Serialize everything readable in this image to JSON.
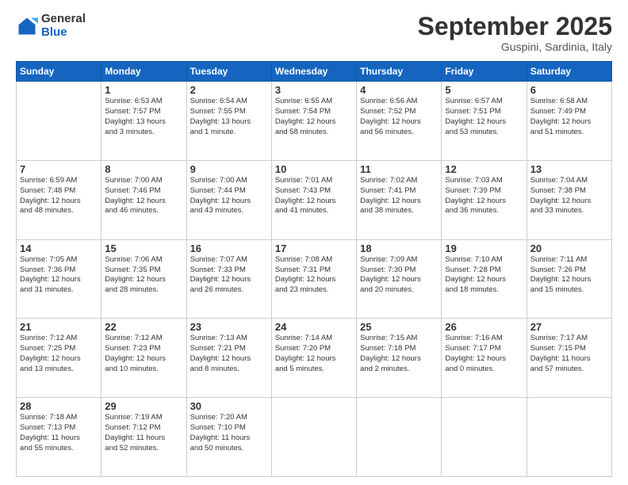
{
  "header": {
    "logo_general": "General",
    "logo_blue": "Blue",
    "month_title": "September 2025",
    "subtitle": "Guspini, Sardinia, Italy"
  },
  "days_of_week": [
    "Sunday",
    "Monday",
    "Tuesday",
    "Wednesday",
    "Thursday",
    "Friday",
    "Saturday"
  ],
  "weeks": [
    [
      {
        "day": "",
        "info": ""
      },
      {
        "day": "1",
        "info": "Sunrise: 6:53 AM\nSunset: 7:57 PM\nDaylight: 13 hours\nand 3 minutes."
      },
      {
        "day": "2",
        "info": "Sunrise: 6:54 AM\nSunset: 7:55 PM\nDaylight: 13 hours\nand 1 minute."
      },
      {
        "day": "3",
        "info": "Sunrise: 6:55 AM\nSunset: 7:54 PM\nDaylight: 12 hours\nand 58 minutes."
      },
      {
        "day": "4",
        "info": "Sunrise: 6:56 AM\nSunset: 7:52 PM\nDaylight: 12 hours\nand 56 minutes."
      },
      {
        "day": "5",
        "info": "Sunrise: 6:57 AM\nSunset: 7:51 PM\nDaylight: 12 hours\nand 53 minutes."
      },
      {
        "day": "6",
        "info": "Sunrise: 6:58 AM\nSunset: 7:49 PM\nDaylight: 12 hours\nand 51 minutes."
      }
    ],
    [
      {
        "day": "7",
        "info": "Sunrise: 6:59 AM\nSunset: 7:48 PM\nDaylight: 12 hours\nand 48 minutes."
      },
      {
        "day": "8",
        "info": "Sunrise: 7:00 AM\nSunset: 7:46 PM\nDaylight: 12 hours\nand 46 minutes."
      },
      {
        "day": "9",
        "info": "Sunrise: 7:00 AM\nSunset: 7:44 PM\nDaylight: 12 hours\nand 43 minutes."
      },
      {
        "day": "10",
        "info": "Sunrise: 7:01 AM\nSunset: 7:43 PM\nDaylight: 12 hours\nand 41 minutes."
      },
      {
        "day": "11",
        "info": "Sunrise: 7:02 AM\nSunset: 7:41 PM\nDaylight: 12 hours\nand 38 minutes."
      },
      {
        "day": "12",
        "info": "Sunrise: 7:03 AM\nSunset: 7:39 PM\nDaylight: 12 hours\nand 36 minutes."
      },
      {
        "day": "13",
        "info": "Sunrise: 7:04 AM\nSunset: 7:38 PM\nDaylight: 12 hours\nand 33 minutes."
      }
    ],
    [
      {
        "day": "14",
        "info": "Sunrise: 7:05 AM\nSunset: 7:36 PM\nDaylight: 12 hours\nand 31 minutes."
      },
      {
        "day": "15",
        "info": "Sunrise: 7:06 AM\nSunset: 7:35 PM\nDaylight: 12 hours\nand 28 minutes."
      },
      {
        "day": "16",
        "info": "Sunrise: 7:07 AM\nSunset: 7:33 PM\nDaylight: 12 hours\nand 26 minutes."
      },
      {
        "day": "17",
        "info": "Sunrise: 7:08 AM\nSunset: 7:31 PM\nDaylight: 12 hours\nand 23 minutes."
      },
      {
        "day": "18",
        "info": "Sunrise: 7:09 AM\nSunset: 7:30 PM\nDaylight: 12 hours\nand 20 minutes."
      },
      {
        "day": "19",
        "info": "Sunrise: 7:10 AM\nSunset: 7:28 PM\nDaylight: 12 hours\nand 18 minutes."
      },
      {
        "day": "20",
        "info": "Sunrise: 7:11 AM\nSunset: 7:26 PM\nDaylight: 12 hours\nand 15 minutes."
      }
    ],
    [
      {
        "day": "21",
        "info": "Sunrise: 7:12 AM\nSunset: 7:25 PM\nDaylight: 12 hours\nand 13 minutes."
      },
      {
        "day": "22",
        "info": "Sunrise: 7:12 AM\nSunset: 7:23 PM\nDaylight: 12 hours\nand 10 minutes."
      },
      {
        "day": "23",
        "info": "Sunrise: 7:13 AM\nSunset: 7:21 PM\nDaylight: 12 hours\nand 8 minutes."
      },
      {
        "day": "24",
        "info": "Sunrise: 7:14 AM\nSunset: 7:20 PM\nDaylight: 12 hours\nand 5 minutes."
      },
      {
        "day": "25",
        "info": "Sunrise: 7:15 AM\nSunset: 7:18 PM\nDaylight: 12 hours\nand 2 minutes."
      },
      {
        "day": "26",
        "info": "Sunrise: 7:16 AM\nSunset: 7:17 PM\nDaylight: 12 hours\nand 0 minutes."
      },
      {
        "day": "27",
        "info": "Sunrise: 7:17 AM\nSunset: 7:15 PM\nDaylight: 11 hours\nand 57 minutes."
      }
    ],
    [
      {
        "day": "28",
        "info": "Sunrise: 7:18 AM\nSunset: 7:13 PM\nDaylight: 11 hours\nand 55 minutes."
      },
      {
        "day": "29",
        "info": "Sunrise: 7:19 AM\nSunset: 7:12 PM\nDaylight: 11 hours\nand 52 minutes."
      },
      {
        "day": "30",
        "info": "Sunrise: 7:20 AM\nSunset: 7:10 PM\nDaylight: 11 hours\nand 50 minutes."
      },
      {
        "day": "",
        "info": ""
      },
      {
        "day": "",
        "info": ""
      },
      {
        "day": "",
        "info": ""
      },
      {
        "day": "",
        "info": ""
      }
    ]
  ]
}
